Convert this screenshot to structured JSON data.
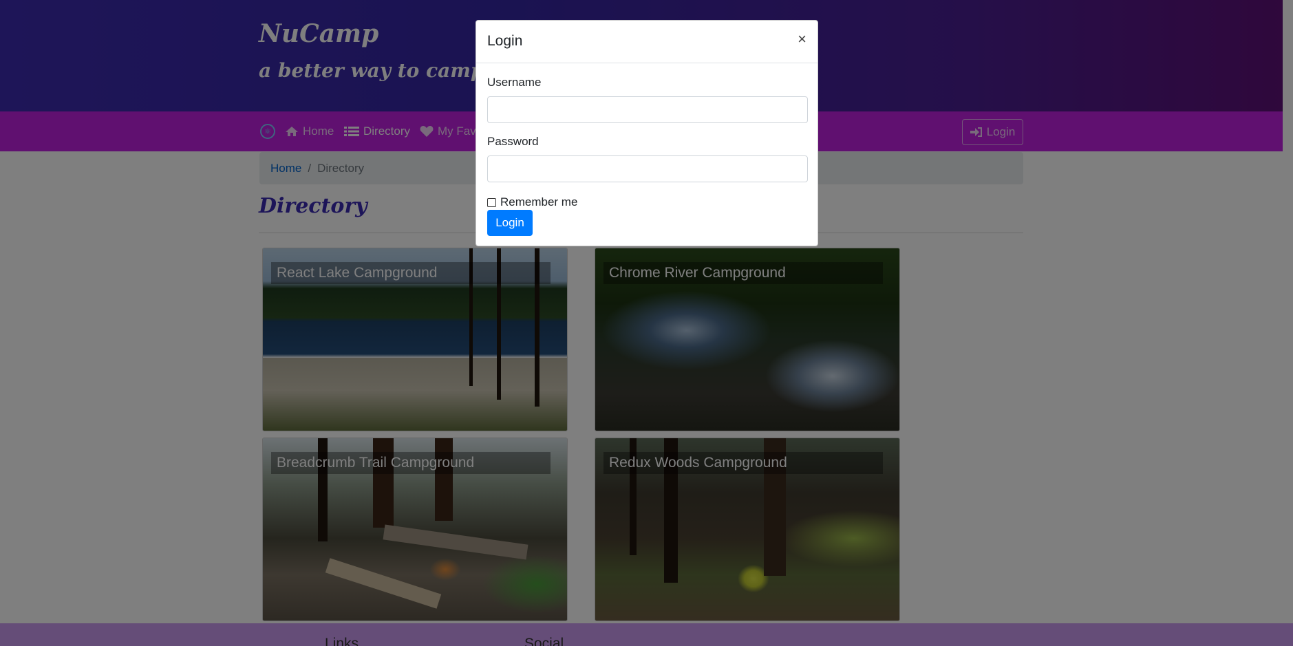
{
  "header": {
    "brand": "NuCamp",
    "tagline": "a better way to camp"
  },
  "navbar": {
    "items": [
      {
        "label": "Home",
        "icon": "home-icon"
      },
      {
        "label": "Directory",
        "icon": "list-icon"
      },
      {
        "label": "My Fave",
        "icon": "heart-icon"
      }
    ],
    "login_label": "Login"
  },
  "breadcrumb": {
    "home": "Home",
    "separator": "/",
    "current": "Directory"
  },
  "page": {
    "title": "Directory"
  },
  "campsites": [
    {
      "name": "React Lake Campground"
    },
    {
      "name": "Chrome River Campground"
    },
    {
      "name": "Breadcrumb Trail Campground"
    },
    {
      "name": "Redux Woods Campground"
    }
  ],
  "footer": {
    "links_heading": "Links",
    "social_heading": "Social"
  },
  "modal": {
    "title": "Login",
    "close": "×",
    "username_label": "Username",
    "password_label": "Password",
    "remember_label": "Remember me",
    "submit_label": "Login"
  },
  "colors": {
    "primary_button": "#007bff",
    "navbar": "#c020e0",
    "heading": "#3b2ab3"
  }
}
